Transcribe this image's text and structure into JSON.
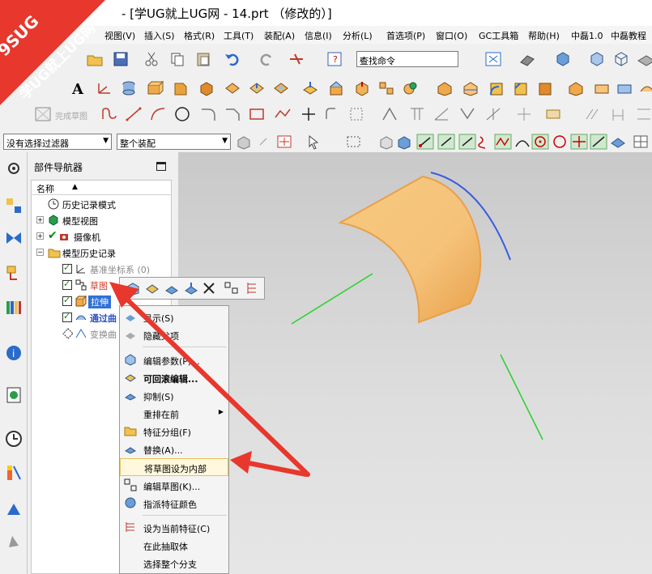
{
  "window": {
    "title": "- [学UG就上UG网 - 14.prt （修改的）]"
  },
  "watermark": {
    "line1": "9SUG",
    "line2": "学UG就上UG网"
  },
  "menubar": {
    "items": [
      "视图(V)",
      "插入(S)",
      "格式(R)",
      "工具(T)",
      "装配(A)",
      "信息(I)",
      "分析(L)",
      "首选项(P)",
      "窗口(O)",
      "GC工具箱",
      "帮助(H)",
      "中磊1.0",
      "中磊教程"
    ]
  },
  "toolbar": {
    "search_placeholder": "查找命令",
    "sketch_done_label": "完成草图"
  },
  "filters": {
    "selection_filter": "没有选择过滤器",
    "assembly_scope": "整个装配"
  },
  "navigator": {
    "title": "部件导航器",
    "column_name": "名称",
    "nodes": {
      "history_mode": "历史记录模式",
      "model_views": "模型视图",
      "camera": "摄像机",
      "model_history": "模型历史记录",
      "datum_csys": "基准坐标系 (0)",
      "sketch": "草图",
      "extrude": "拉伸",
      "through_curves": "通过曲",
      "transform_curve": "变换曲"
    }
  },
  "context_menu": {
    "items": [
      "显示(S)",
      "隐藏父项",
      "编辑参数(P)...",
      "可回滚编辑...",
      "抑制(S)",
      "重排在前",
      "特征分组(F)",
      "替换(A)...",
      "将草图设为内部",
      "编辑草图(K)...",
      "指派特征颜色",
      "设为当前特征(C)",
      "在此抽取体",
      "选择整个分支"
    ]
  },
  "colors": {
    "accent_red": "#e8372c",
    "menu_highlight": "#fff8dc",
    "surface_orange": "#f6c47c"
  }
}
